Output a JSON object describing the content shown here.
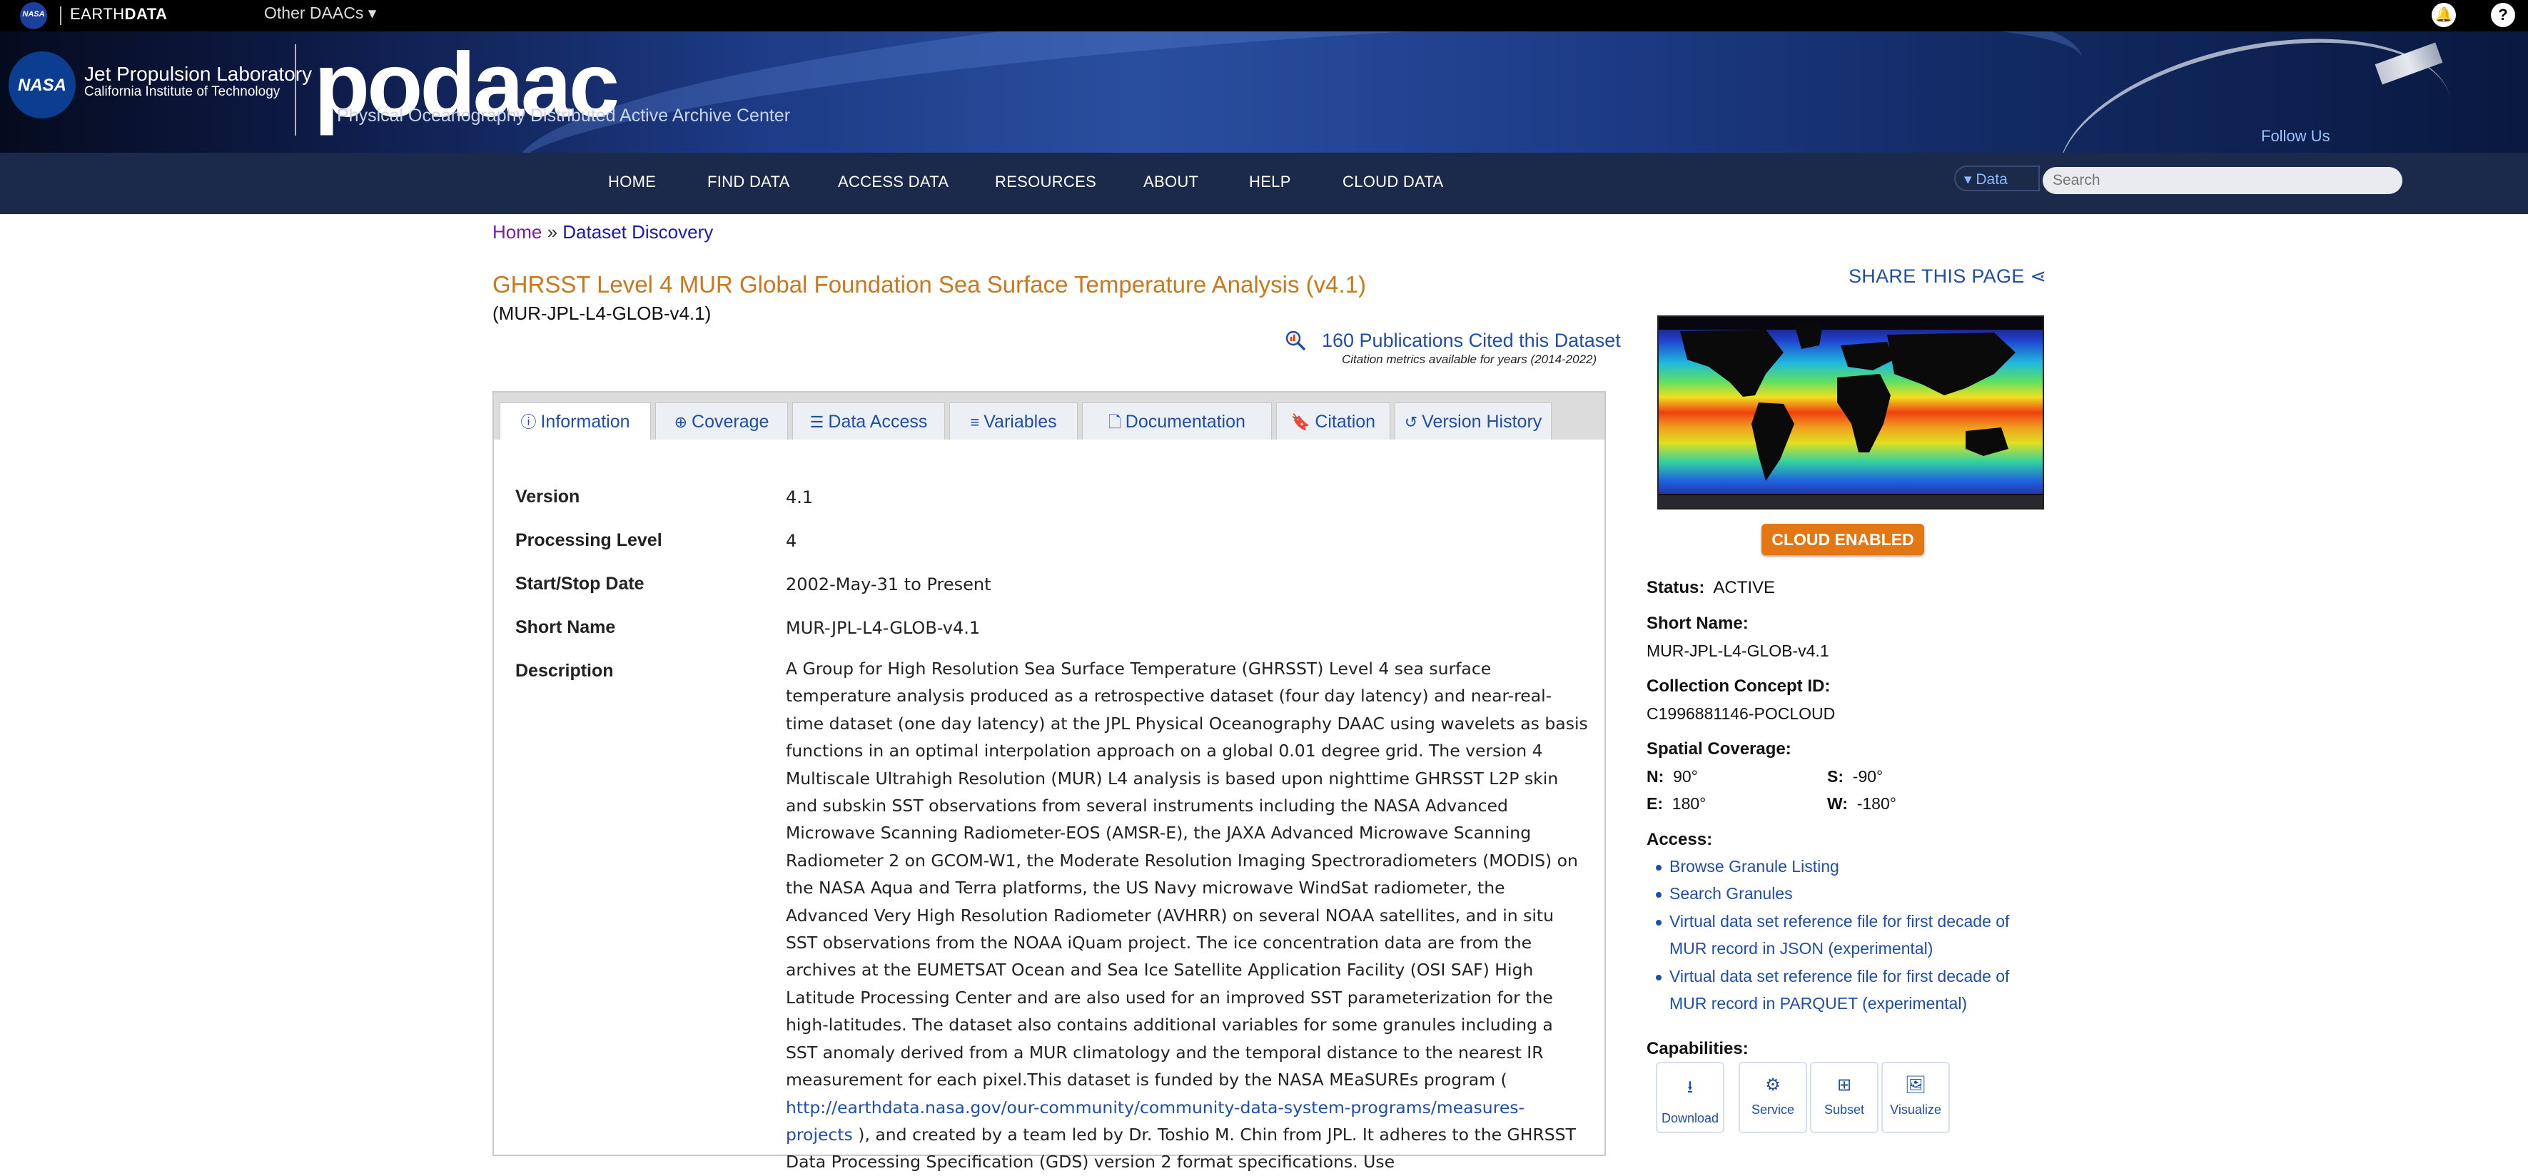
{
  "topbar": {
    "nasa": "NASA",
    "earthdata_prefix": "EARTH",
    "earthdata_suffix": "DATA",
    "other_daacs": "Other DAACs ▾"
  },
  "banner": {
    "nasa": "NASA",
    "jpl_line1": "Jet Propulsion Laboratory",
    "jpl_line2": "California Institute of Technology",
    "logo_text": "podaac",
    "logo_sub": "Physical Oceanography Distributed Active Archive Center",
    "follow": "Follow Us"
  },
  "nav": {
    "items": [
      "HOME",
      "FIND DATA",
      "ACCESS DATA",
      "RESOURCES",
      "ABOUT",
      "HELP",
      "CLOUD DATA"
    ],
    "data_select": "Data",
    "search_placeholder": "Search"
  },
  "breadcrumb": {
    "home": "Home",
    "sep": " » ",
    "current": "Dataset Discovery"
  },
  "dataset": {
    "title": "GHRSST Level 4 MUR Global Foundation Sea Surface Temperature Analysis (v4.1)",
    "short_name_paren": "(MUR-JPL-L4-GLOB-v4.1)",
    "publications": "160 Publications Cited this Dataset",
    "citation_metrics": "Citation metrics available for years (2014-2022)"
  },
  "tabs": [
    "Information",
    "Coverage",
    "Data Access",
    "Variables",
    "Documentation",
    "Citation",
    "Version History"
  ],
  "info": {
    "version_label": "Version",
    "version": "4.1",
    "level_label": "Processing Level",
    "level": "4",
    "dates_label": "Start/Stop Date",
    "dates": "2002-May-31 to Present",
    "short_label": "Short Name",
    "short": "MUR-JPL-L4-GLOB-v4.1",
    "desc_label": "Description",
    "desc_part1": "A Group for High Resolution Sea Surface Temperature (GHRSST) Level 4 sea surface temperature analysis produced as a retrospective dataset (four day latency) and near-real-time dataset (one day latency) at the JPL Physical Oceanography DAAC using wavelets as basis functions in an optimal interpolation approach on a global 0.01 degree grid. The version 4 Multiscale Ultrahigh Resolution (MUR) L4 analysis is based upon nighttime GHRSST L2P skin and subskin SST observations from several instruments including the NASA Advanced Microwave Scanning Radiometer-EOS (AMSR-E), the JAXA Advanced Microwave Scanning Radiometer 2 on GCOM-W1, the Moderate Resolution Imaging Spectroradiometers (MODIS) on the NASA Aqua and Terra platforms, the US Navy microwave WindSat radiometer, the Advanced Very High Resolution Radiometer (AVHRR) on several NOAA satellites, and in situ SST observations from the NOAA iQuam project. The ice concentration data are from the archives at the EUMETSAT Ocean and Sea Ice Satellite Application Facility (OSI SAF) High Latitude Processing Center and are also used for an improved SST parameterization for the high-latitudes. The dataset also contains additional variables for some granules including a SST anomaly derived from a MUR climatology and the temporal distance to the nearest IR measurement for each pixel.This dataset is funded by the NASA MEaSUREs program ( ",
    "desc_link": "http://earthdata.nasa.gov/our-community/community-data-system-programs/measures-projects",
    "desc_part2": " ), and created by a team led by Dr. Toshio M. Chin from JPL. It adheres to the GHRSST Data Processing Specification (GDS) version 2 format specifications. Use"
  },
  "sidebar": {
    "share": "SHARE THIS PAGE",
    "cloud": "CLOUD ENABLED",
    "status_label": "Status:",
    "status": "ACTIVE",
    "short_label": "Short Name:",
    "short": "MUR-JPL-L4-GLOB-v4.1",
    "ccid_label": "Collection Concept ID:",
    "ccid": "C1996881146-POCLOUD",
    "spatial_label": "Spatial Coverage:",
    "n_label": "N:",
    "n": "90°",
    "s_label": "S:",
    "s": "-90°",
    "e_label": "E:",
    "e": "180°",
    "w_label": "W:",
    "w": "-180°",
    "access_label": "Access:",
    "access": [
      "Browse Granule Listing",
      "Search Granules",
      "Virtual data set reference file for first decade of",
      "MUR record in JSON (experimental)",
      "Virtual data set reference file for first decade of",
      "MUR record in PARQUET (experimental)"
    ],
    "capabilities_label": "Capabilities:",
    "capabilities": [
      "Download",
      "Service",
      "Subset",
      "Visualize"
    ]
  }
}
